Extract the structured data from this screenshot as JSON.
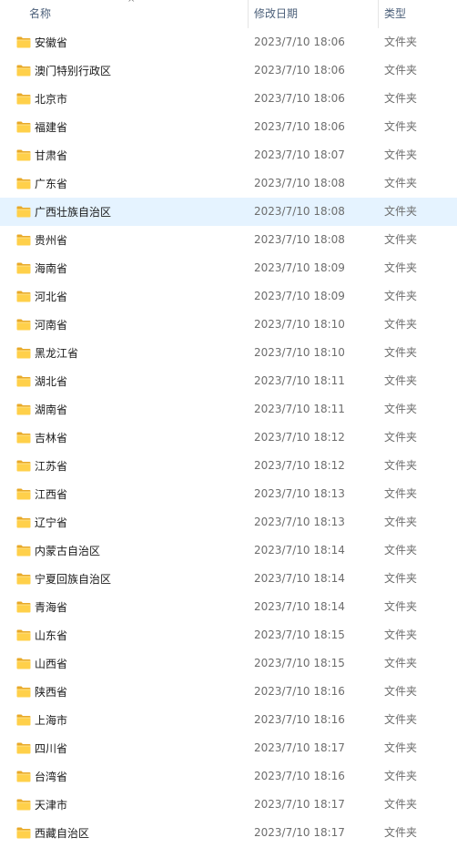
{
  "header": {
    "name_label": "名称",
    "date_label": "修改日期",
    "type_label": "类型",
    "sort_indicator": "^"
  },
  "selected_index": 6,
  "colors": {
    "selection": "#e5f3ff",
    "folder_front": "#ffd04a",
    "folder_back": "#e8a928"
  },
  "rows": [
    {
      "name": "安徽省",
      "date": "2023/7/10 18:06",
      "type": "文件夹"
    },
    {
      "name": "澳门特别行政区",
      "date": "2023/7/10 18:06",
      "type": "文件夹"
    },
    {
      "name": "北京市",
      "date": "2023/7/10 18:06",
      "type": "文件夹"
    },
    {
      "name": "福建省",
      "date": "2023/7/10 18:06",
      "type": "文件夹"
    },
    {
      "name": "甘肃省",
      "date": "2023/7/10 18:07",
      "type": "文件夹"
    },
    {
      "name": "广东省",
      "date": "2023/7/10 18:08",
      "type": "文件夹"
    },
    {
      "name": "广西壮族自治区",
      "date": "2023/7/10 18:08",
      "type": "文件夹"
    },
    {
      "name": "贵州省",
      "date": "2023/7/10 18:08",
      "type": "文件夹"
    },
    {
      "name": "海南省",
      "date": "2023/7/10 18:09",
      "type": "文件夹"
    },
    {
      "name": "河北省",
      "date": "2023/7/10 18:09",
      "type": "文件夹"
    },
    {
      "name": "河南省",
      "date": "2023/7/10 18:10",
      "type": "文件夹"
    },
    {
      "name": "黑龙江省",
      "date": "2023/7/10 18:10",
      "type": "文件夹"
    },
    {
      "name": "湖北省",
      "date": "2023/7/10 18:11",
      "type": "文件夹"
    },
    {
      "name": "湖南省",
      "date": "2023/7/10 18:11",
      "type": "文件夹"
    },
    {
      "name": "吉林省",
      "date": "2023/7/10 18:12",
      "type": "文件夹"
    },
    {
      "name": "江苏省",
      "date": "2023/7/10 18:12",
      "type": "文件夹"
    },
    {
      "name": "江西省",
      "date": "2023/7/10 18:13",
      "type": "文件夹"
    },
    {
      "name": "辽宁省",
      "date": "2023/7/10 18:13",
      "type": "文件夹"
    },
    {
      "name": "内蒙古自治区",
      "date": "2023/7/10 18:14",
      "type": "文件夹"
    },
    {
      "name": "宁夏回族自治区",
      "date": "2023/7/10 18:14",
      "type": "文件夹"
    },
    {
      "name": "青海省",
      "date": "2023/7/10 18:14",
      "type": "文件夹"
    },
    {
      "name": "山东省",
      "date": "2023/7/10 18:15",
      "type": "文件夹"
    },
    {
      "name": "山西省",
      "date": "2023/7/10 18:15",
      "type": "文件夹"
    },
    {
      "name": "陕西省",
      "date": "2023/7/10 18:16",
      "type": "文件夹"
    },
    {
      "name": "上海市",
      "date": "2023/7/10 18:16",
      "type": "文件夹"
    },
    {
      "name": "四川省",
      "date": "2023/7/10 18:17",
      "type": "文件夹"
    },
    {
      "name": "台湾省",
      "date": "2023/7/10 18:16",
      "type": "文件夹"
    },
    {
      "name": "天津市",
      "date": "2023/7/10 18:17",
      "type": "文件夹"
    },
    {
      "name": "西藏自治区",
      "date": "2023/7/10 18:17",
      "type": "文件夹"
    }
  ]
}
